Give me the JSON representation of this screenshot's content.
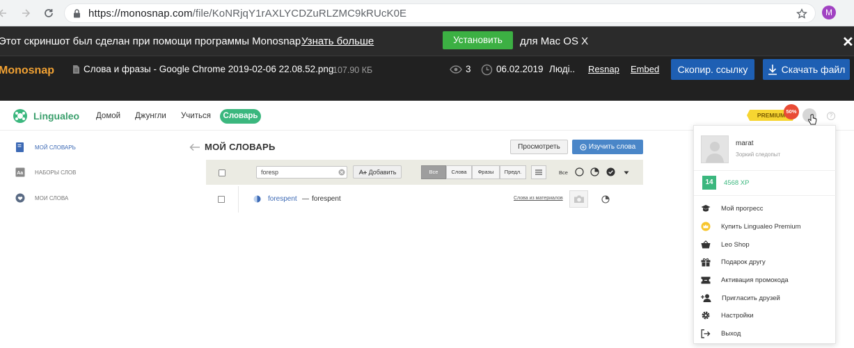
{
  "browser": {
    "url_host": "https://monosnap.com",
    "url_path": "/file/KoNRjqY1rAXLYCDZuRLZMC9kRUcK0E",
    "profile_initial": "M"
  },
  "banner": {
    "text": "Этот скриншот был сделан при помощи программы Monosnap",
    "link": "Узнать больше",
    "install_label": "Установить",
    "suffix": "для Mac OS X",
    "close": "✕"
  },
  "filebar": {
    "brand": "Monosnap",
    "file_name": "Слова и фразы - Google Chrome 2019-02-06 22.08.52.png",
    "file_size": "107.90 КБ",
    "views": "3",
    "date": "06.02.2019",
    "people": "Люді..",
    "resnap": "Resnap",
    "embed": "Embed",
    "copy_link": "Скопир. ссылку",
    "download": "Скачать файл"
  },
  "site": {
    "logo": "Lingualeo",
    "nav": [
      "Домой",
      "Джунгли",
      "Учиться",
      "Словарь"
    ],
    "premium": "PREMIUM",
    "discount": "50%"
  },
  "sidebar": {
    "items": [
      {
        "label": "МОЙ СЛОВАРЬ",
        "icon": "book-icon",
        "active": true
      },
      {
        "label": "НАБОРЫ СЛОВ",
        "icon": "word-sets-icon",
        "active": false
      },
      {
        "label": "МОИ СЛОВА",
        "icon": "heart-icon",
        "active": false
      }
    ]
  },
  "dictionary": {
    "title": "МОЙ СЛОВАРЬ",
    "view_btn": "Просмотреть",
    "learn_btn": "Изучить слова",
    "search_value": "foresp",
    "add_btn": "Добавить",
    "filters": [
      "Все",
      "Слова",
      "Фразы",
      "Предл."
    ],
    "status_all": "Все",
    "rows": [
      {
        "word": "forespent",
        "dash": "—",
        "translation": "forespent",
        "source": "Слова из материалов"
      }
    ]
  },
  "user_menu": {
    "name": "marat",
    "title": "Зоркий следопыт",
    "level": "14",
    "xp": "4568 XP",
    "items": [
      {
        "label": "Мой прогресс",
        "icon": "graduation-cap-icon"
      },
      {
        "label": "Купить Lingualeo Premium",
        "icon": "crown-icon"
      },
      {
        "label": "Leo Shop",
        "icon": "basket-icon"
      },
      {
        "label": "Подарок другу",
        "icon": "gift-icon"
      },
      {
        "label": "Активация промокода",
        "icon": "ticket-icon"
      },
      {
        "label": "Пригласить друзей",
        "icon": "add-user-icon"
      },
      {
        "label": "Настройки",
        "icon": "gear-icon"
      },
      {
        "label": "Выход",
        "icon": "logout-icon"
      }
    ]
  },
  "colors": {
    "accent_green": "#3bb77e",
    "link_blue": "#3d6ab5",
    "button_blue": "#1e5fb3",
    "install_green": "#3cb043",
    "brand_orange": "#f2a233"
  }
}
